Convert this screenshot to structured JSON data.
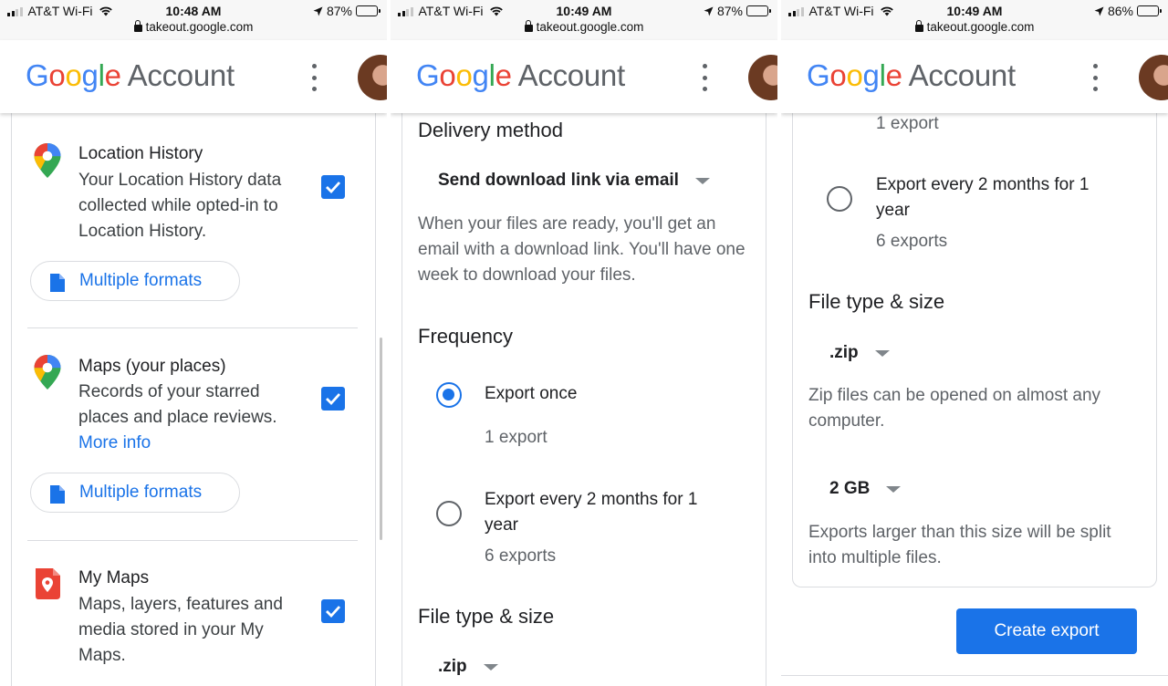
{
  "status_bars": [
    {
      "carrier": "AT&T Wi-Fi",
      "time": "10:48 AM",
      "battery": "87%",
      "battery_level": 0.87,
      "url": "takeout.google.com"
    },
    {
      "carrier": "AT&T Wi-Fi",
      "time": "10:49 AM",
      "battery": "87%",
      "battery_level": 0.87,
      "url": "takeout.google.com"
    },
    {
      "carrier": "AT&T Wi-Fi",
      "time": "10:49 AM",
      "battery": "86%",
      "battery_level": 0.86,
      "url": "takeout.google.com"
    }
  ],
  "header": {
    "logo_letters": [
      "G",
      "o",
      "o",
      "g",
      "l",
      "e"
    ],
    "logo_suffix": "Account",
    "brand_colors": {
      "blue": "#4285F4",
      "red": "#EA4335",
      "yellow": "#FBBC05",
      "green": "#34A853"
    },
    "menu_icon": "more-vert-icon",
    "avatar_icon": "user-avatar"
  },
  "panel1": {
    "products": [
      {
        "title": "Location History",
        "desc": "Your Location History data collected while opted-in to Location History.",
        "icon": "google-maps-pin-icon",
        "checked": true,
        "format_button": "Multiple formats"
      },
      {
        "title": "Maps (your places)",
        "desc": "Records of your starred places and place reviews.",
        "link": "More info",
        "icon": "google-maps-pin-icon",
        "checked": true,
        "format_button": "Multiple formats"
      },
      {
        "title": "My Maps",
        "desc": "Maps, layers, features and media stored in your My Maps.",
        "icon": "my-maps-icon",
        "checked": true
      }
    ]
  },
  "panel2": {
    "delivery": {
      "heading": "Delivery method",
      "selected": "Send download link via email",
      "help": "When your files are ready, you'll get an email with a download link. You'll have one week to download your files."
    },
    "frequency": {
      "heading": "Frequency",
      "options": [
        {
          "label": "Export once",
          "sub": "1 export",
          "selected": true
        },
        {
          "label": "Export every 2 months for 1 year",
          "sub": "6 exports",
          "selected": false
        }
      ]
    },
    "file": {
      "heading": "File type & size",
      "type": ".zip"
    }
  },
  "panel3": {
    "top_sub": "1 export",
    "option": {
      "label": "Export every 2 months for 1 year",
      "sub": "6 exports",
      "selected": false
    },
    "file": {
      "heading": "File type & size",
      "type": ".zip",
      "type_help": "Zip files can be opened on almost any computer.",
      "size": "2 GB",
      "size_help": "Exports larger than this size will be split into multiple files."
    },
    "create_button": "Create export"
  },
  "colors": {
    "accent": "#1a73e8",
    "text": "#202124",
    "secondary": "#5f6368",
    "border": "#dadce0"
  }
}
